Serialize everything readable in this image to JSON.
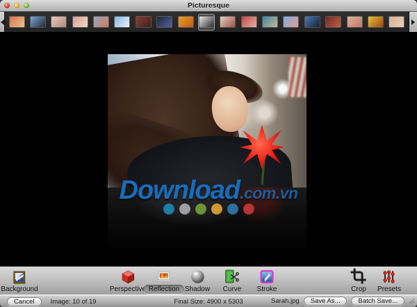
{
  "window": {
    "title": "Picturesque"
  },
  "titlebar": {
    "buttons": [
      {
        "id": "close"
      },
      {
        "id": "minimize"
      },
      {
        "id": "zoom"
      }
    ]
  },
  "filmstrip": {
    "selected_index": 9,
    "thumbnails": [
      {
        "c1": "#d4764a",
        "c2": "#f0c090"
      },
      {
        "c1": "#6fa8d8",
        "c2": "#2a2a30"
      },
      {
        "c1": "#e8c8c0",
        "c2": "#b08878"
      },
      {
        "c1": "#d8a090",
        "c2": "#f0d8c8"
      },
      {
        "c1": "#90a8c0",
        "c2": "#d87858"
      },
      {
        "c1": "#88b8e0",
        "c2": "#e8f0f8"
      },
      {
        "c1": "#8a4030",
        "c2": "#3a2020"
      },
      {
        "c1": "#202838",
        "c2": "#5060a0"
      },
      {
        "c1": "#e8a020",
        "c2": "#c05818"
      },
      {
        "c1": "#e8e8e8",
        "c2": "#282828",
        "selected": true
      },
      {
        "c1": "#e0d0c8",
        "c2": "#a05040"
      },
      {
        "c1": "#c04848",
        "c2": "#e8b0a0"
      },
      {
        "c1": "#3888a8",
        "c2": "#c8b890"
      },
      {
        "c1": "#78b0e0",
        "c2": "#e89890"
      },
      {
        "c1": "#4878c0",
        "c2": "#182028"
      },
      {
        "c1": "#702828",
        "c2": "#c06040"
      },
      {
        "c1": "#e0b0a0",
        "c2": "#c07860"
      },
      {
        "c1": "#e8c030",
        "c2": "#a04818"
      },
      {
        "c1": "#d8b090",
        "c2": "#e8d0b8"
      }
    ]
  },
  "watermark": {
    "text_main": "Download",
    "text_suffix": ".com.vn",
    "text_color": "#1a6cb8",
    "dots": [
      "#1d7ea8",
      "#9e9e9e",
      "#6d9334",
      "#cf9830",
      "#2d6f9e",
      "#b63436"
    ]
  },
  "toolbar": {
    "items": [
      {
        "id": "background",
        "label": "Background"
      },
      {
        "id": "perspective",
        "label": "Perspective"
      },
      {
        "id": "reflection",
        "label": "Reflection",
        "selected": true
      },
      {
        "id": "shadow",
        "label": "Shadow"
      },
      {
        "id": "curve",
        "label": "Curve"
      },
      {
        "id": "stroke",
        "label": "Stroke"
      },
      {
        "id": "crop",
        "label": "Crop"
      },
      {
        "id": "presets",
        "label": "Presets"
      }
    ]
  },
  "statusbar": {
    "cancel_label": "Cancel",
    "image_count": "Image: 10 of 19",
    "final_size": "Final Size: 4900 x 5303",
    "filename": "Sarah.jpg",
    "save_as_label": "Save As...",
    "batch_save_label": "Batch Save..."
  }
}
